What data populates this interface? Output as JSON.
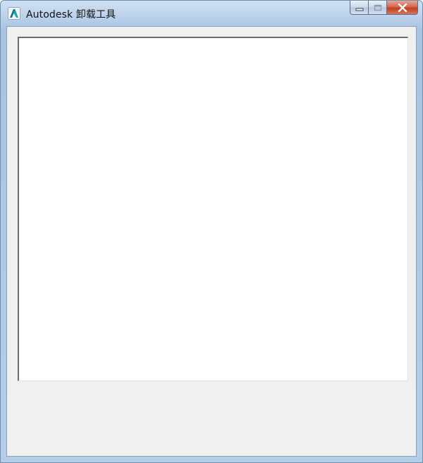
{
  "window": {
    "title": "Autodesk 卸载工具",
    "app_icon": "autodesk-logo-icon",
    "caption_buttons": [
      {
        "name": "minimize",
        "icon": "minimize-icon"
      },
      {
        "name": "maximize",
        "icon": "maximize-icon"
      },
      {
        "name": "close",
        "icon": "close-icon"
      }
    ]
  },
  "content": {
    "panel": "empty"
  },
  "colors": {
    "title_bar": "#bcd2ea",
    "client_bg": "#f0f0f0",
    "panel_bg": "#ffffff",
    "close_button": "#c94a2c"
  }
}
